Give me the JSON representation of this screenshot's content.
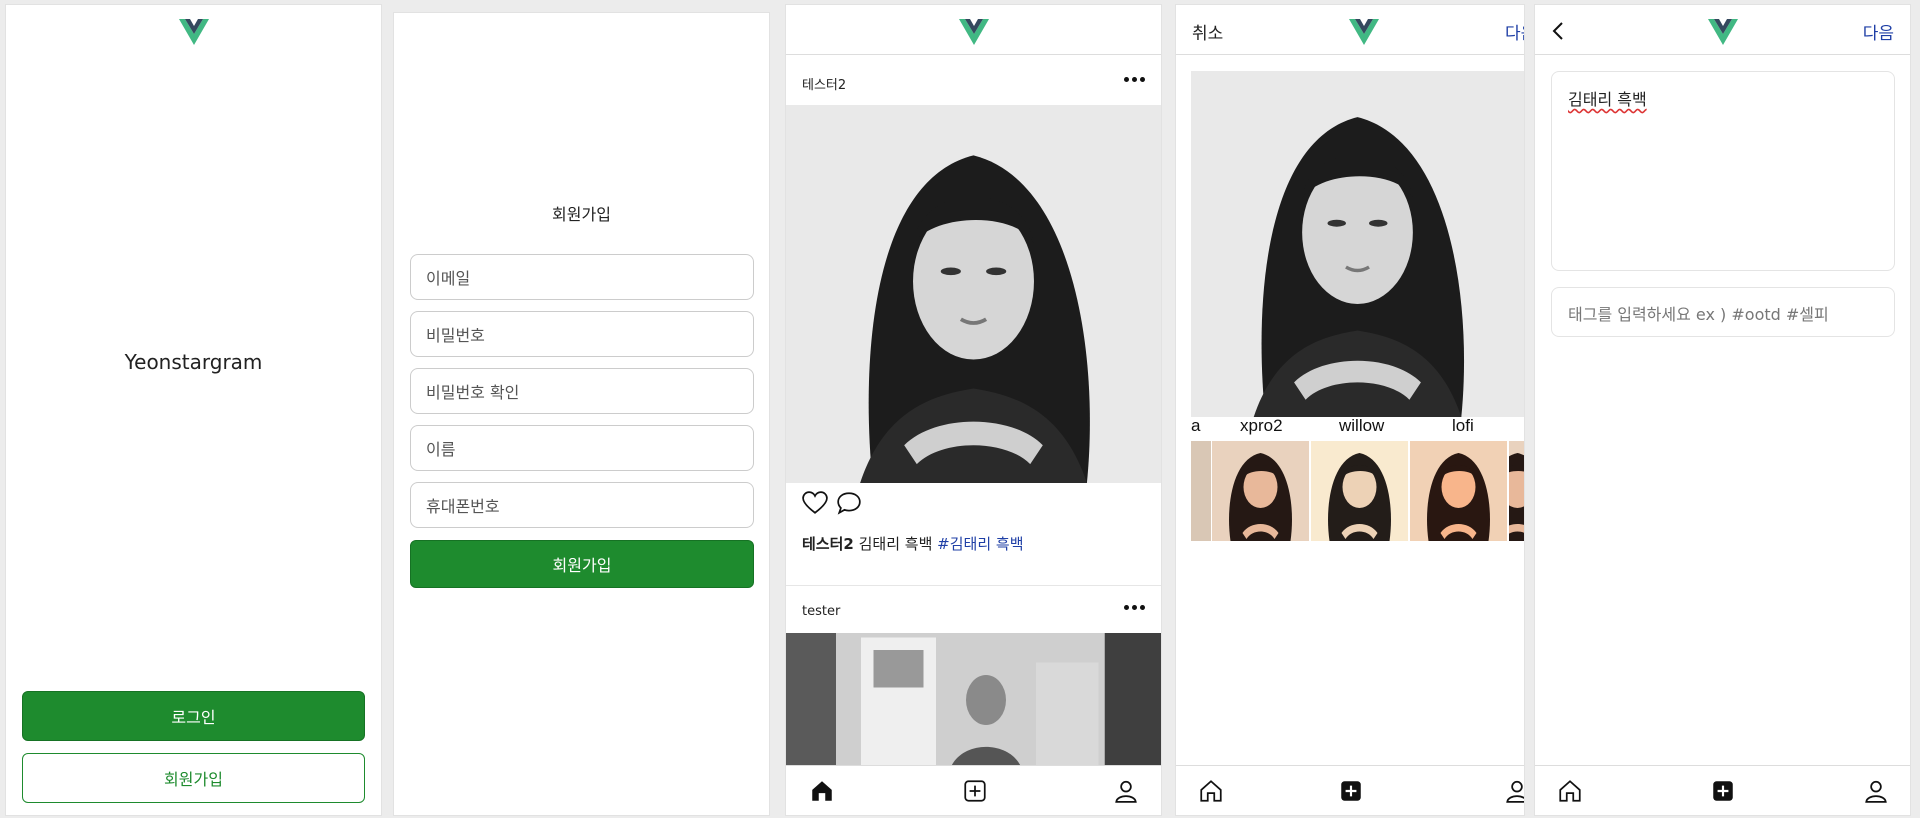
{
  "colors": {
    "green": "#1e8b2e",
    "blue": "#1f3fa6",
    "vue_dark": "#34495e",
    "vue_green": "#41b883"
  },
  "screen1": {
    "logo": "vue-logo",
    "title": "Yeonstargram",
    "login_label": "로그인",
    "signup_label": "회원가입"
  },
  "screen2": {
    "title": "회원가입",
    "fields": [
      {
        "placeholder": "이메일"
      },
      {
        "placeholder": "비밀번호"
      },
      {
        "placeholder": "비밀번호 확인"
      },
      {
        "placeholder": "이름"
      },
      {
        "placeholder": "휴대폰번호"
      }
    ],
    "submit_label": "회원가입"
  },
  "screen3": {
    "posts": [
      {
        "user": "테스터2",
        "caption_user": "테스터2",
        "caption_text": " 김태리 흑백 ",
        "caption_tag": "#김태리 흑백"
      },
      {
        "user": "tester"
      }
    ],
    "nav": [
      "home-icon",
      "add-post-icon",
      "profile-icon"
    ]
  },
  "screen4": {
    "cancel": "취소",
    "next": "다음",
    "filters": [
      "a",
      "xpro2",
      "willow",
      "lofi"
    ]
  },
  "screen5": {
    "next": "다음",
    "content_text": "김태리  흑백",
    "tag_placeholder": "태그를 입력하세요 ex ) #ootd #셀피"
  }
}
